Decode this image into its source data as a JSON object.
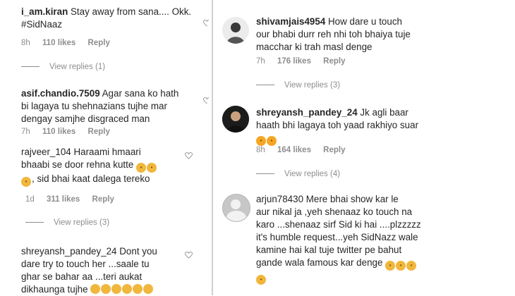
{
  "left": [
    {
      "user": "i_am.kiran",
      "text_lines": [
        "Stay away from sana.... Okk.",
        "#SidNaaz"
      ],
      "time": "8h",
      "likes": "110 likes",
      "reply": "Reply",
      "view_replies": "View replies (1)"
    },
    {
      "user": "asif.chandio.7509",
      "text_lines": [
        "Agar sana ko hath",
        "bi lagaya tu shehnazians tujhe mar",
        "dengay samjhe disgraced man"
      ],
      "time": "7h",
      "likes": "110 likes",
      "reply": "Reply"
    },
    {
      "user": "rajveer_104",
      "text_lines": [
        "Haraami hmaari",
        "bhaabi se door rehna kutte",
        ", sid bhai kaat dalega tereko"
      ],
      "time": "1d",
      "likes": "311 likes",
      "reply": "Reply",
      "view_replies": "View replies (3)"
    },
    {
      "user": "shreyansh_pandey_24",
      "text_lines": [
        "Dont you",
        "dare try to touch her ...saale tu",
        "ghar se bahar aa ...teri aukat",
        "dikhaunga tujhe"
      ]
    }
  ],
  "right": [
    {
      "user": "shivamjais4954",
      "text_lines": [
        "How dare u touch",
        "our bhabi durr reh nhi toh bhaiya tuje",
        "macchar ki trah masl denge"
      ],
      "time": "7h",
      "likes": "176 likes",
      "reply": "Reply",
      "view_replies": "View replies (3)"
    },
    {
      "user": "shreyansh_pandey_24",
      "text_lines": [
        "Jk agli baar",
        "haath bhi lagaya toh yaad rakhiyo suar"
      ],
      "time": "8h",
      "likes": "164 likes",
      "reply": "Reply",
      "view_replies": "View replies (4)"
    },
    {
      "user": "arjun78430",
      "text_lines": [
        "Mere bhai show kar le",
        "aur nikal ja ,yeh shenaaz ko touch na",
        "karo ...shenaaz sirf Sid ki hai ....plzzzzz",
        "it's humble request...yeh SidNazz wale",
        "kamine hai kal tuje twitter pe bahut",
        "gande wala famous kar denge"
      ]
    }
  ],
  "icons": {
    "heart": "heart-icon",
    "emoji": "emoji-icon"
  }
}
